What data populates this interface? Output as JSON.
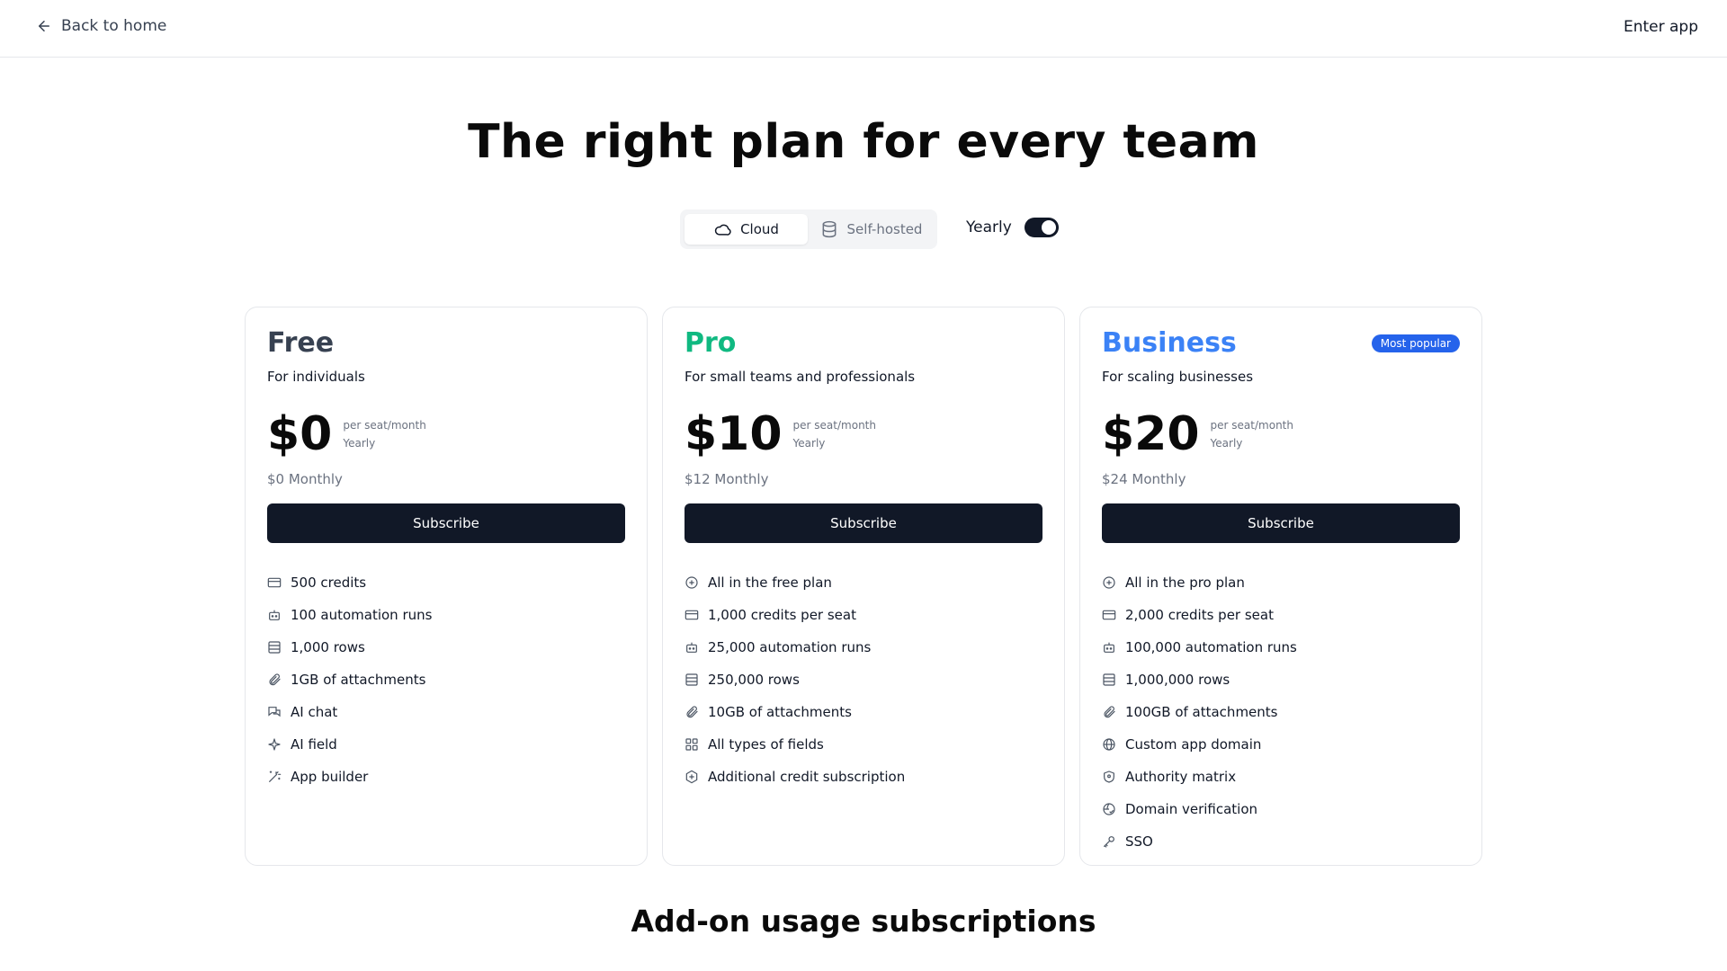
{
  "header": {
    "back_label": "Back to home",
    "enter_label": "Enter app"
  },
  "hero": {
    "title": "The right plan for every team"
  },
  "deployment_toggle": {
    "options": [
      {
        "label": "Cloud",
        "icon": "cloud-icon",
        "selected": true
      },
      {
        "label": "Self-hosted",
        "icon": "database-icon",
        "selected": false
      }
    ]
  },
  "billing_toggle": {
    "label": "Yearly",
    "on": true
  },
  "plans": [
    {
      "name": "Free",
      "color": "#374151",
      "description": "For individuals",
      "price": "$0",
      "per_label": "per seat/month",
      "period_label": "Yearly",
      "monthly_label": "$0 Monthly",
      "cta": "Subscribe",
      "features": [
        {
          "icon": "credit-card-icon",
          "label": "500 credits"
        },
        {
          "icon": "robot-icon",
          "label": "100 automation runs"
        },
        {
          "icon": "table-rows-icon",
          "label": "1,000 rows"
        },
        {
          "icon": "paperclip-icon",
          "label": "1GB of attachments"
        },
        {
          "icon": "chat-icon",
          "label": "AI chat"
        },
        {
          "icon": "sparkle-icon",
          "label": "AI field"
        },
        {
          "icon": "magic-wand-icon",
          "label": "App builder"
        }
      ]
    },
    {
      "name": "Pro",
      "color": "#10b981",
      "description": "For small teams and professionals",
      "price": "$10",
      "per_label": "per seat/month",
      "period_label": "Yearly",
      "monthly_label": "$12 Monthly",
      "cta": "Subscribe",
      "features": [
        {
          "icon": "plus-circle-icon",
          "label": "All in the free plan"
        },
        {
          "icon": "credit-card-icon",
          "label": "1,000 credits per seat"
        },
        {
          "icon": "robot-icon",
          "label": "25,000 automation runs"
        },
        {
          "icon": "table-rows-icon",
          "label": "250,000 rows"
        },
        {
          "icon": "paperclip-icon",
          "label": "10GB of attachments"
        },
        {
          "icon": "grid-icon",
          "label": "All types of fields"
        },
        {
          "icon": "hexagon-plus-icon",
          "label": "Additional credit subscription"
        }
      ]
    },
    {
      "name": "Business",
      "color": "#3b82f6",
      "badge": "Most popular",
      "description": "For scaling businesses",
      "price": "$20",
      "per_label": "per seat/month",
      "period_label": "Yearly",
      "monthly_label": "$24 Monthly",
      "cta": "Subscribe",
      "features": [
        {
          "icon": "plus-circle-icon",
          "label": "All in the pro plan"
        },
        {
          "icon": "credit-card-icon",
          "label": "2,000 credits per seat"
        },
        {
          "icon": "robot-icon",
          "label": "100,000 automation runs"
        },
        {
          "icon": "table-rows-icon",
          "label": "1,000,000 rows"
        },
        {
          "icon": "paperclip-icon",
          "label": "100GB of attachments"
        },
        {
          "icon": "globe-icon",
          "label": "Custom app domain"
        },
        {
          "icon": "shield-icon",
          "label": "Authority matrix"
        },
        {
          "icon": "globe-check-icon",
          "label": "Domain verification"
        },
        {
          "icon": "key-icon",
          "label": "SSO"
        }
      ]
    }
  ],
  "addons": {
    "title": "Add-on usage subscriptions"
  },
  "colors": {
    "button_dark": "#111827",
    "badge_blue": "#2563eb",
    "muted_text": "#6b7280",
    "border": "#e5e7eb"
  }
}
